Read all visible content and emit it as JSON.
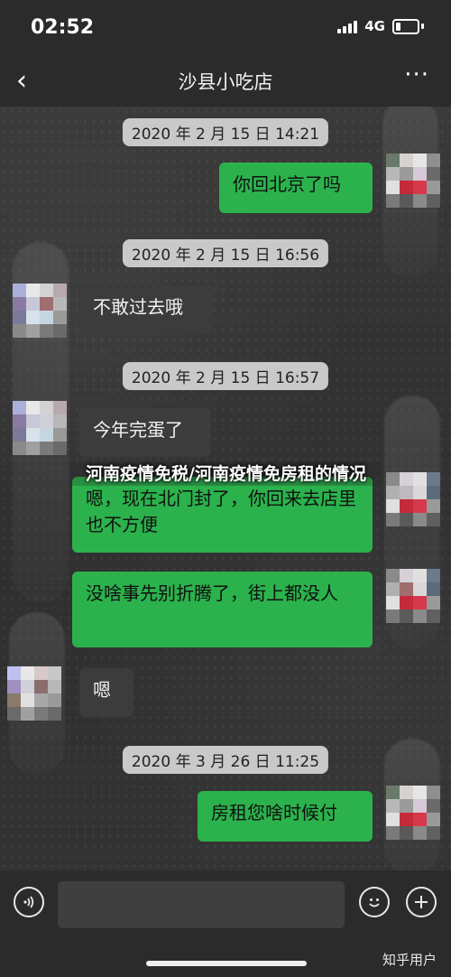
{
  "status": {
    "time": "02:52",
    "network": "4G"
  },
  "nav": {
    "back_glyph": "‹",
    "title": "沙县小吃店",
    "more_glyph": "···"
  },
  "messages": [
    {
      "type": "timestamp",
      "text": "2020 年 2 月 15 日 14:21"
    },
    {
      "type": "out",
      "text": "你回北京了吗"
    },
    {
      "type": "timestamp",
      "text": "2020 年 2 月 15 日 16:56"
    },
    {
      "type": "in",
      "text": "不敢过去哦"
    },
    {
      "type": "timestamp",
      "text": "2020 年 2 月 15 日 16:57"
    },
    {
      "type": "in",
      "text": "今年完蛋了"
    },
    {
      "type": "out",
      "text": "嗯，现在北门封了，你回来去店里也不方便"
    },
    {
      "type": "out",
      "text": "没啥事先别折腾了，街上都没人"
    },
    {
      "type": "in",
      "text": "嗯"
    },
    {
      "type": "timestamp",
      "text": "2020 年 3 月 26 日 11:25"
    },
    {
      "type": "out",
      "text": "房租您啥时候付"
    }
  ],
  "overlay_caption": "河南疫情免税/河南疫情免房租的情况",
  "input": {
    "voice_icon": "voice-icon",
    "emoji_icon": "emoji-icon",
    "add_icon": "add-icon"
  },
  "watermark": "知乎用户",
  "colors": {
    "out_bubble": "#2bb24c",
    "in_bubble": "#3c3c3c",
    "timestamp_bg": "#c9c9c9"
  }
}
